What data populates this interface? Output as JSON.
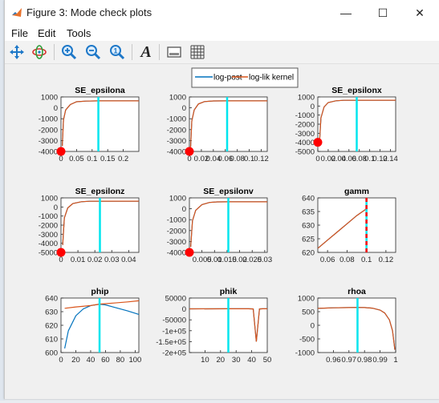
{
  "window": {
    "title": "Figure 3: Mode check plots",
    "minimize_glyph": "—",
    "maximize_glyph": "☐",
    "close_glyph": "✕"
  },
  "menu": {
    "file": "File",
    "edit": "Edit",
    "tools": "Tools"
  },
  "toolbar": {
    "icons": [
      "pan-icon",
      "rotate-icon",
      "zoom-in-icon",
      "zoom-out-icon",
      "restore-view-icon",
      "insert-text-icon",
      "axes-box-icon",
      "grid-icon"
    ],
    "text_glyph": "A"
  },
  "legend": {
    "entries": [
      "log-post",
      "log-lik kernel"
    ]
  },
  "colors": {
    "log_post": "#0072bd",
    "log_lik_kernel": "#d95319",
    "mode_line": "#00e5ee",
    "mode_marker": "#ff0000",
    "gamm_dashed": "#ff0000"
  },
  "chart_data": [
    {
      "type": "line",
      "title": "SE_epsilona",
      "xlabel": "",
      "ylabel": "",
      "xlim": [
        0,
        0.25
      ],
      "ylim": [
        -4000,
        1000
      ],
      "xticks": [
        0,
        0.05,
        0.1,
        0.15,
        0.2
      ],
      "xticklabels": [
        "0",
        "0.05",
        "0.1",
        "0.15",
        "0.2"
      ],
      "yticks": [
        -4000,
        -3000,
        -2000,
        -1000,
        0,
        1000
      ],
      "yticklabels": [
        "-4000",
        "-3000",
        "-2000",
        "-1000",
        "0",
        "1000"
      ],
      "mode_x": 0.12,
      "marker": [
        0,
        -4000
      ],
      "series": [
        {
          "name": "log-post",
          "values": [
            [
              0.004,
              -3500
            ],
            [
              0.008,
              -1100
            ],
            [
              0.015,
              -200
            ],
            [
              0.03,
              300
            ],
            [
              0.05,
              560
            ],
            [
              0.08,
              620
            ],
            [
              0.12,
              640
            ],
            [
              0.25,
              640
            ]
          ]
        },
        {
          "name": "log-lik kernel",
          "values": [
            [
              0.004,
              -3500
            ],
            [
              0.008,
              -1100
            ],
            [
              0.015,
              -200
            ],
            [
              0.03,
              300
            ],
            [
              0.05,
              560
            ],
            [
              0.08,
              620
            ],
            [
              0.12,
              640
            ],
            [
              0.25,
              640
            ]
          ]
        }
      ]
    },
    {
      "type": "line",
      "title": "",
      "xlabel": "",
      "ylabel": "",
      "xlim": [
        0,
        0.13
      ],
      "ylim": [
        -4000,
        1000
      ],
      "xticks": [
        0,
        0.02,
        0.04,
        0.06,
        0.08,
        0.1,
        0.12
      ],
      "xticklabels": [
        "0",
        "0.02",
        "0.04",
        "0.06",
        "0.08",
        "0.1",
        "0.12"
      ],
      "yticks": [
        -4000,
        -3000,
        -2000,
        -1000,
        0,
        1000
      ],
      "yticklabels": [
        "-4000",
        "-3000",
        "-2000",
        "-1000",
        "0",
        "1000"
      ],
      "mode_x": 0.063,
      "marker": [
        0,
        -4000
      ],
      "series": [
        {
          "name": "log-post",
          "values": [
            [
              0.002,
              -3600
            ],
            [
              0.004,
              -1200
            ],
            [
              0.008,
              -200
            ],
            [
              0.015,
              350
            ],
            [
              0.025,
              570
            ],
            [
              0.04,
              630
            ],
            [
              0.063,
              640
            ],
            [
              0.13,
              640
            ]
          ]
        },
        {
          "name": "log-lik kernel",
          "values": [
            [
              0.002,
              -3600
            ],
            [
              0.004,
              -1200
            ],
            [
              0.008,
              -200
            ],
            [
              0.015,
              350
            ],
            [
              0.025,
              570
            ],
            [
              0.04,
              630
            ],
            [
              0.063,
              640
            ],
            [
              0.13,
              640
            ]
          ]
        }
      ]
    },
    {
      "type": "line",
      "title": "SE_epsilonx",
      "xlabel": "",
      "ylabel": "",
      "xlim": [
        0,
        0.15
      ],
      "ylim": [
        -5000,
        1000
      ],
      "xticks": [
        0,
        0.02,
        0.04,
        0.06,
        0.08,
        0.1,
        0.12,
        0.14
      ],
      "xticklabels": [
        "0",
        "0.02",
        "0.04",
        "0.06",
        "0.08",
        "0.1",
        "0.12",
        "0.14"
      ],
      "yticks": [
        -5000,
        -4000,
        -3000,
        -2000,
        -1000,
        0,
        1000
      ],
      "yticklabels": [
        "-5000",
        "-4000",
        "-3000",
        "-2000",
        "-1000",
        "0",
        "1000"
      ],
      "mode_x": 0.075,
      "marker": [
        0,
        -4000
      ],
      "series": [
        {
          "name": "log-post",
          "values": [
            [
              0.003,
              -4300
            ],
            [
              0.006,
              -1300
            ],
            [
              0.012,
              -100
            ],
            [
              0.02,
              380
            ],
            [
              0.035,
              580
            ],
            [
              0.05,
              630
            ],
            [
              0.075,
              640
            ],
            [
              0.15,
              640
            ]
          ]
        },
        {
          "name": "log-lik kernel",
          "values": [
            [
              0.003,
              -4300
            ],
            [
              0.006,
              -1300
            ],
            [
              0.012,
              -100
            ],
            [
              0.02,
              380
            ],
            [
              0.035,
              580
            ],
            [
              0.05,
              630
            ],
            [
              0.075,
              640
            ],
            [
              0.15,
              640
            ]
          ]
        }
      ]
    },
    {
      "type": "line",
      "title": "SE_epsilonz",
      "xlabel": "",
      "ylabel": "",
      "xlim": [
        0,
        0.046
      ],
      "ylim": [
        -5000,
        1000
      ],
      "xticks": [
        0,
        0.01,
        0.02,
        0.03,
        0.04
      ],
      "xticklabels": [
        "0",
        "0.01",
        "0.02",
        "0.03",
        "0.04"
      ],
      "yticks": [
        -5000,
        -4000,
        -3000,
        -2000,
        -1000,
        0,
        1000
      ],
      "yticklabels": [
        "-5000",
        "-4000",
        "-3000",
        "-2000",
        "-1000",
        "0",
        "1000"
      ],
      "mode_x": 0.023,
      "marker": [
        0,
        -5000
      ],
      "series": [
        {
          "name": "log-post",
          "values": [
            [
              0.001,
              -4200
            ],
            [
              0.002,
              -1200
            ],
            [
              0.004,
              -100
            ],
            [
              0.007,
              380
            ],
            [
              0.012,
              580
            ],
            [
              0.017,
              630
            ],
            [
              0.023,
              640
            ],
            [
              0.046,
              640
            ]
          ]
        },
        {
          "name": "log-lik kernel",
          "values": [
            [
              0.001,
              -4200
            ],
            [
              0.002,
              -1200
            ],
            [
              0.004,
              -100
            ],
            [
              0.007,
              380
            ],
            [
              0.012,
              580
            ],
            [
              0.017,
              630
            ],
            [
              0.023,
              640
            ],
            [
              0.046,
              640
            ]
          ]
        }
      ]
    },
    {
      "type": "line",
      "title": "SE_epsilonv",
      "xlabel": "",
      "ylabel": "",
      "xlim": [
        0,
        0.031
      ],
      "ylim": [
        -4000,
        1000
      ],
      "xticks": [
        0.005,
        0.01,
        0.015,
        0.02,
        0.025,
        0.03
      ],
      "xticklabels": [
        "0.005",
        "0.01",
        "0.015",
        "0.02",
        "0.025",
        "0.03"
      ],
      "yticks": [
        -4000,
        -3000,
        -2000,
        -1000,
        0,
        1000
      ],
      "yticklabels": [
        "-4000",
        "-3000",
        "-2000",
        "-1000",
        "0",
        "1000"
      ],
      "mode_x": 0.0155,
      "marker": [
        0,
        -4000
      ],
      "series": [
        {
          "name": "log-post",
          "values": [
            [
              0.0005,
              -3500
            ],
            [
              0.0012,
              -1100
            ],
            [
              0.0025,
              -150
            ],
            [
              0.005,
              380
            ],
            [
              0.008,
              580
            ],
            [
              0.011,
              630
            ],
            [
              0.0155,
              640
            ],
            [
              0.031,
              640
            ]
          ]
        },
        {
          "name": "log-lik kernel",
          "values": [
            [
              0.0005,
              -3500
            ],
            [
              0.0012,
              -1100
            ],
            [
              0.0025,
              -150
            ],
            [
              0.005,
              380
            ],
            [
              0.008,
              580
            ],
            [
              0.011,
              630
            ],
            [
              0.0155,
              640
            ],
            [
              0.031,
              640
            ]
          ]
        }
      ]
    },
    {
      "type": "line",
      "title": "gamm",
      "xlabel": "",
      "ylabel": "",
      "xlim": [
        0.05,
        0.13
      ],
      "ylim": [
        620,
        640
      ],
      "xticks": [
        0.06,
        0.08,
        0.1,
        0.12
      ],
      "xticklabels": [
        "0.06",
        "0.08",
        "0.1",
        "0.12"
      ],
      "yticks": [
        620,
        625,
        630,
        635,
        640
      ],
      "yticklabels": [
        "620",
        "625",
        "630",
        "635",
        "640"
      ],
      "mode_x": 0.1,
      "mode_dashed": true,
      "series": [
        {
          "name": "log-post",
          "values": [
            [
              0.05,
              621.5
            ],
            [
              0.06,
              624.5
            ],
            [
              0.07,
              627.5
            ],
            [
              0.08,
              630.5
            ],
            [
              0.09,
              633.5
            ],
            [
              0.1,
              636
            ]
          ]
        },
        {
          "name": "log-lik kernel",
          "values": [
            [
              0.05,
              621.5
            ],
            [
              0.06,
              624.5
            ],
            [
              0.07,
              627.5
            ],
            [
              0.08,
              630.5
            ],
            [
              0.09,
              633.5
            ],
            [
              0.1,
              636
            ]
          ]
        }
      ]
    },
    {
      "type": "line",
      "title": "phip",
      "xlabel": "",
      "ylabel": "",
      "xlim": [
        0,
        105
      ],
      "ylim": [
        600,
        640
      ],
      "xticks": [
        0,
        20,
        40,
        60,
        80,
        100
      ],
      "xticklabels": [
        "0",
        "20",
        "40",
        "60",
        "80",
        "100"
      ],
      "yticks": [
        600,
        610,
        620,
        630,
        640
      ],
      "yticklabels": [
        "600",
        "610",
        "620",
        "630",
        "640"
      ],
      "mode_x": 52,
      "series": [
        {
          "name": "log-post",
          "values": [
            [
              5,
              603
            ],
            [
              10,
              616
            ],
            [
              20,
              627
            ],
            [
              30,
              632
            ],
            [
              40,
              634.5
            ],
            [
              52,
              635.5
            ],
            [
              60,
              635
            ],
            [
              70,
              633.5
            ],
            [
              80,
              632
            ],
            [
              90,
              630.5
            ],
            [
              105,
              628
            ]
          ]
        },
        {
          "name": "log-lik kernel",
          "values": [
            [
              5,
              632.5
            ],
            [
              20,
              633.5
            ],
            [
              40,
              634.5
            ],
            [
              52,
              635.5
            ],
            [
              70,
              636.3
            ],
            [
              90,
              637.2
            ],
            [
              105,
              638
            ]
          ]
        }
      ]
    },
    {
      "type": "line",
      "title": "phik",
      "xlabel": "",
      "ylabel": "",
      "xlim": [
        0,
        50
      ],
      "ylim": [
        -200000,
        50000
      ],
      "xticks": [
        10,
        20,
        30,
        40,
        50
      ],
      "xticklabels": [
        "10",
        "20",
        "30",
        "40",
        "50"
      ],
      "yticks": [
        -200000,
        -150000,
        -100000,
        -50000,
        0,
        50000
      ],
      "yticklabels": [
        "-2e+05",
        "-1.5e+05",
        "-1e+05",
        "-50000",
        "0",
        "50000"
      ],
      "mode_x": 25,
      "series": [
        {
          "name": "log-post",
          "values": [
            [
              0,
              500
            ],
            [
              25,
              600
            ],
            [
              38,
              600
            ],
            [
              41,
              0
            ],
            [
              43,
              -150000
            ],
            [
              45,
              0
            ],
            [
              47,
              600
            ],
            [
              50,
              600
            ]
          ]
        },
        {
          "name": "log-lik kernel",
          "values": [
            [
              0,
              500
            ],
            [
              25,
              600
            ],
            [
              38,
              600
            ],
            [
              41,
              0
            ],
            [
              43,
              -150000
            ],
            [
              45,
              0
            ],
            [
              47,
              600
            ],
            [
              50,
              600
            ]
          ]
        }
      ]
    },
    {
      "type": "line",
      "title": "rhoa",
      "xlabel": "",
      "ylabel": "",
      "xlim": [
        0.95,
        1.0
      ],
      "ylim": [
        -1000,
        1000
      ],
      "xticks": [
        0.96,
        0.97,
        0.98,
        0.99,
        1.0
      ],
      "xticklabels": [
        "0.96",
        "0.97",
        "0.98",
        "0.99",
        "1"
      ],
      "yticks": [
        -1000,
        -500,
        0,
        500,
        1000
      ],
      "yticklabels": [
        "-1000",
        "-500",
        "0",
        "500",
        "1000"
      ],
      "mode_x": 0.9755,
      "series": [
        {
          "name": "log-post",
          "values": [
            [
              0.95,
              620
            ],
            [
              0.96,
              640
            ],
            [
              0.97,
              650
            ],
            [
              0.975,
              655
            ],
            [
              0.98,
              650
            ],
            [
              0.985,
              630
            ],
            [
              0.99,
              560
            ],
            [
              0.993,
              450
            ],
            [
              0.996,
              200
            ],
            [
              0.998,
              -200
            ],
            [
              0.9995,
              -900
            ]
          ]
        },
        {
          "name": "log-lik kernel",
          "values": [
            [
              0.95,
              620
            ],
            [
              0.96,
              640
            ],
            [
              0.97,
              650
            ],
            [
              0.975,
              655
            ],
            [
              0.98,
              650
            ],
            [
              0.985,
              630
            ],
            [
              0.99,
              560
            ],
            [
              0.993,
              450
            ],
            [
              0.996,
              200
            ],
            [
              0.998,
              -200
            ],
            [
              0.9995,
              -900
            ]
          ]
        }
      ]
    }
  ]
}
